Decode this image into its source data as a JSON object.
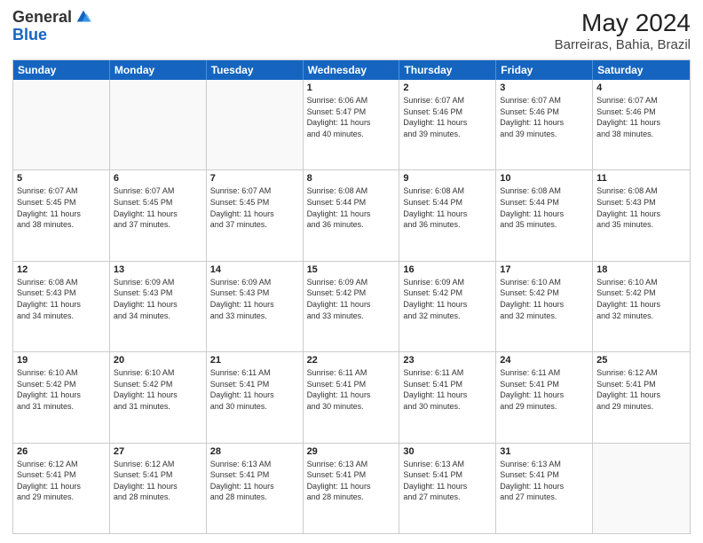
{
  "logo": {
    "general": "General",
    "blue": "Blue"
  },
  "title": "May 2024",
  "subtitle": "Barreiras, Bahia, Brazil",
  "days": [
    "Sunday",
    "Monday",
    "Tuesday",
    "Wednesday",
    "Thursday",
    "Friday",
    "Saturday"
  ],
  "weeks": [
    [
      {
        "day": "",
        "info": ""
      },
      {
        "day": "",
        "info": ""
      },
      {
        "day": "",
        "info": ""
      },
      {
        "day": "1",
        "info": "Sunrise: 6:06 AM\nSunset: 5:47 PM\nDaylight: 11 hours\nand 40 minutes."
      },
      {
        "day": "2",
        "info": "Sunrise: 6:07 AM\nSunset: 5:46 PM\nDaylight: 11 hours\nand 39 minutes."
      },
      {
        "day": "3",
        "info": "Sunrise: 6:07 AM\nSunset: 5:46 PM\nDaylight: 11 hours\nand 39 minutes."
      },
      {
        "day": "4",
        "info": "Sunrise: 6:07 AM\nSunset: 5:46 PM\nDaylight: 11 hours\nand 38 minutes."
      }
    ],
    [
      {
        "day": "5",
        "info": "Sunrise: 6:07 AM\nSunset: 5:45 PM\nDaylight: 11 hours\nand 38 minutes."
      },
      {
        "day": "6",
        "info": "Sunrise: 6:07 AM\nSunset: 5:45 PM\nDaylight: 11 hours\nand 37 minutes."
      },
      {
        "day": "7",
        "info": "Sunrise: 6:07 AM\nSunset: 5:45 PM\nDaylight: 11 hours\nand 37 minutes."
      },
      {
        "day": "8",
        "info": "Sunrise: 6:08 AM\nSunset: 5:44 PM\nDaylight: 11 hours\nand 36 minutes."
      },
      {
        "day": "9",
        "info": "Sunrise: 6:08 AM\nSunset: 5:44 PM\nDaylight: 11 hours\nand 36 minutes."
      },
      {
        "day": "10",
        "info": "Sunrise: 6:08 AM\nSunset: 5:44 PM\nDaylight: 11 hours\nand 35 minutes."
      },
      {
        "day": "11",
        "info": "Sunrise: 6:08 AM\nSunset: 5:43 PM\nDaylight: 11 hours\nand 35 minutes."
      }
    ],
    [
      {
        "day": "12",
        "info": "Sunrise: 6:08 AM\nSunset: 5:43 PM\nDaylight: 11 hours\nand 34 minutes."
      },
      {
        "day": "13",
        "info": "Sunrise: 6:09 AM\nSunset: 5:43 PM\nDaylight: 11 hours\nand 34 minutes."
      },
      {
        "day": "14",
        "info": "Sunrise: 6:09 AM\nSunset: 5:43 PM\nDaylight: 11 hours\nand 33 minutes."
      },
      {
        "day": "15",
        "info": "Sunrise: 6:09 AM\nSunset: 5:42 PM\nDaylight: 11 hours\nand 33 minutes."
      },
      {
        "day": "16",
        "info": "Sunrise: 6:09 AM\nSunset: 5:42 PM\nDaylight: 11 hours\nand 32 minutes."
      },
      {
        "day": "17",
        "info": "Sunrise: 6:10 AM\nSunset: 5:42 PM\nDaylight: 11 hours\nand 32 minutes."
      },
      {
        "day": "18",
        "info": "Sunrise: 6:10 AM\nSunset: 5:42 PM\nDaylight: 11 hours\nand 32 minutes."
      }
    ],
    [
      {
        "day": "19",
        "info": "Sunrise: 6:10 AM\nSunset: 5:42 PM\nDaylight: 11 hours\nand 31 minutes."
      },
      {
        "day": "20",
        "info": "Sunrise: 6:10 AM\nSunset: 5:42 PM\nDaylight: 11 hours\nand 31 minutes."
      },
      {
        "day": "21",
        "info": "Sunrise: 6:11 AM\nSunset: 5:41 PM\nDaylight: 11 hours\nand 30 minutes."
      },
      {
        "day": "22",
        "info": "Sunrise: 6:11 AM\nSunset: 5:41 PM\nDaylight: 11 hours\nand 30 minutes."
      },
      {
        "day": "23",
        "info": "Sunrise: 6:11 AM\nSunset: 5:41 PM\nDaylight: 11 hours\nand 30 minutes."
      },
      {
        "day": "24",
        "info": "Sunrise: 6:11 AM\nSunset: 5:41 PM\nDaylight: 11 hours\nand 29 minutes."
      },
      {
        "day": "25",
        "info": "Sunrise: 6:12 AM\nSunset: 5:41 PM\nDaylight: 11 hours\nand 29 minutes."
      }
    ],
    [
      {
        "day": "26",
        "info": "Sunrise: 6:12 AM\nSunset: 5:41 PM\nDaylight: 11 hours\nand 29 minutes."
      },
      {
        "day": "27",
        "info": "Sunrise: 6:12 AM\nSunset: 5:41 PM\nDaylight: 11 hours\nand 28 minutes."
      },
      {
        "day": "28",
        "info": "Sunrise: 6:13 AM\nSunset: 5:41 PM\nDaylight: 11 hours\nand 28 minutes."
      },
      {
        "day": "29",
        "info": "Sunrise: 6:13 AM\nSunset: 5:41 PM\nDaylight: 11 hours\nand 28 minutes."
      },
      {
        "day": "30",
        "info": "Sunrise: 6:13 AM\nSunset: 5:41 PM\nDaylight: 11 hours\nand 27 minutes."
      },
      {
        "day": "31",
        "info": "Sunrise: 6:13 AM\nSunset: 5:41 PM\nDaylight: 11 hours\nand 27 minutes."
      },
      {
        "day": "",
        "info": ""
      }
    ]
  ]
}
